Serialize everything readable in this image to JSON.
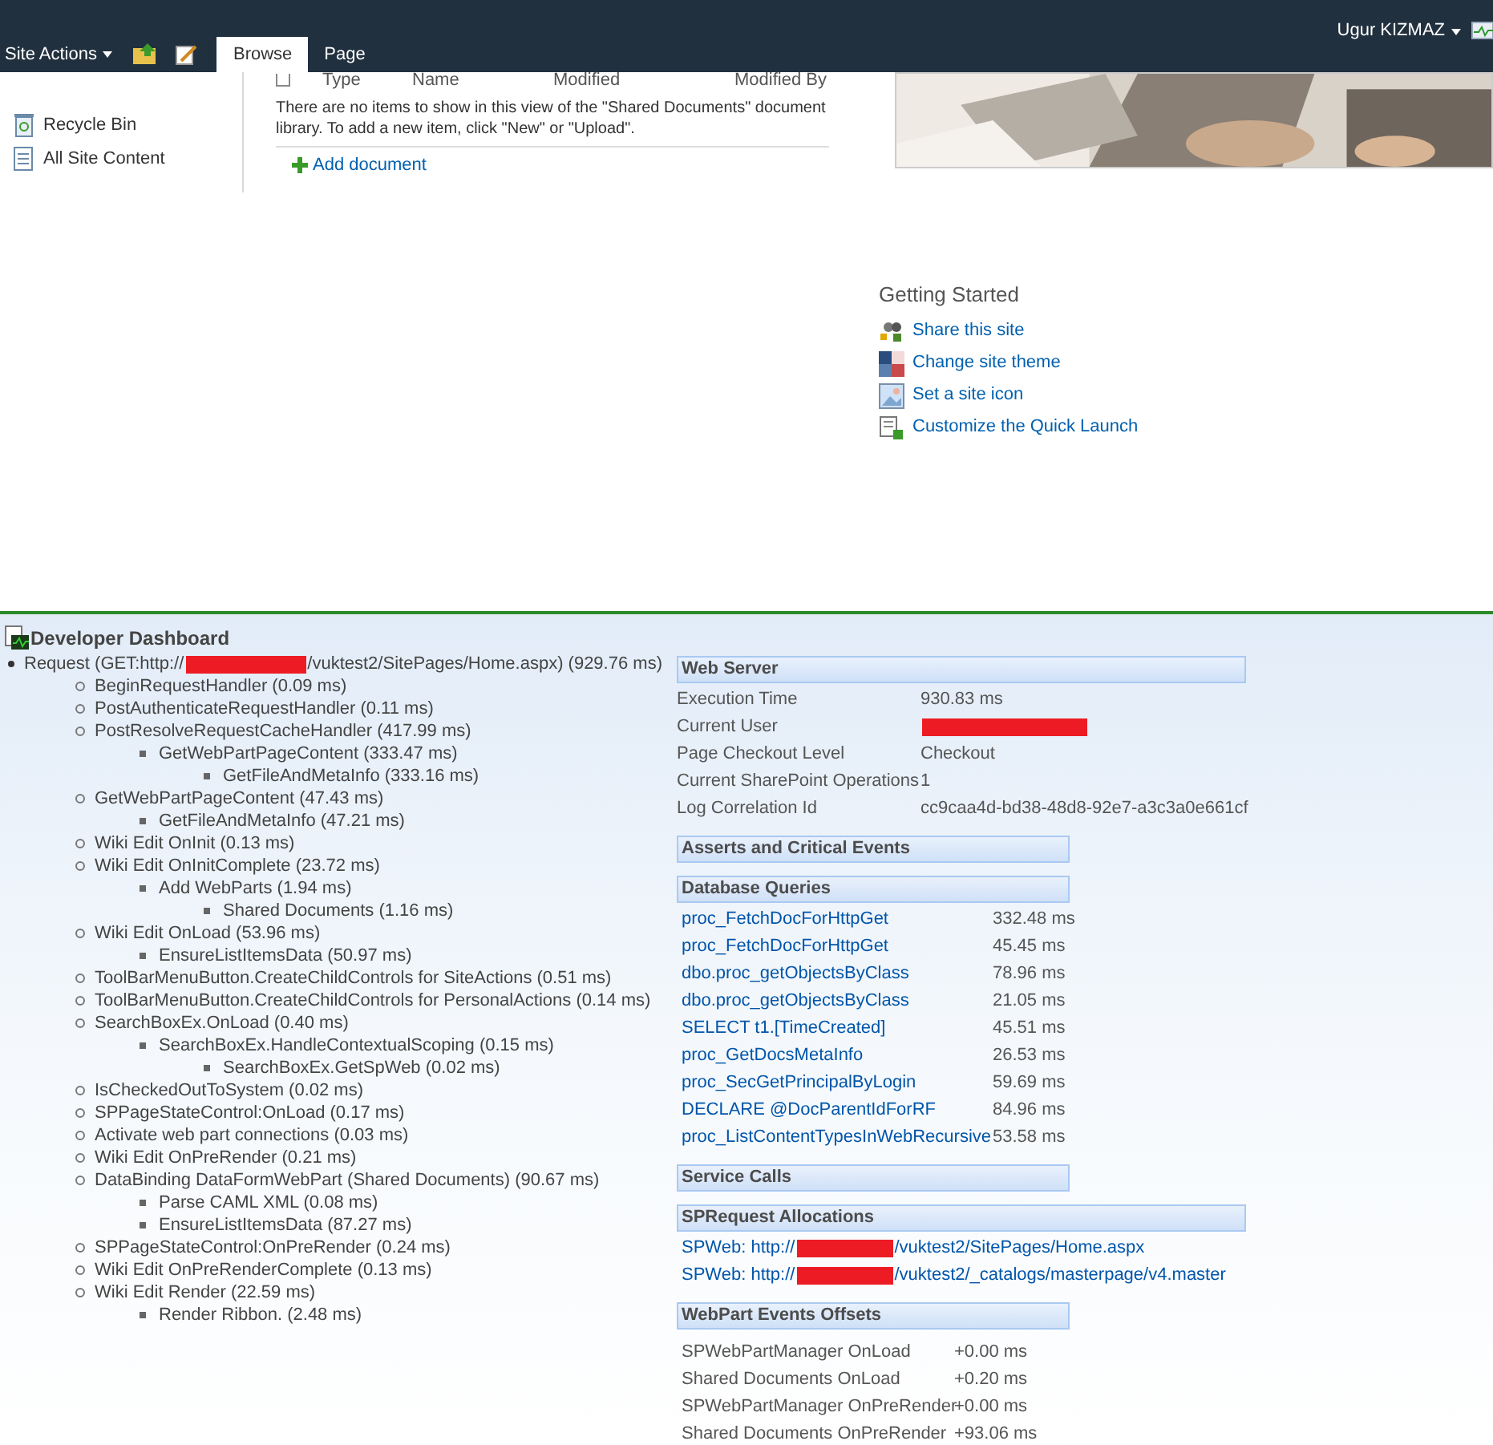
{
  "top_bar": {
    "site_actions": "Site Actions",
    "tabs": [
      {
        "label": "Browse",
        "selected": true
      },
      {
        "label": "Page",
        "selected": false
      }
    ],
    "user": "Ugur KIZMAZ"
  },
  "quick_launch": [
    "Recycle Bin",
    "All Site Content"
  ],
  "library": {
    "columns": [
      "Type",
      "Name",
      "Modified",
      "Modified By"
    ],
    "empty_message": "There are no items to show in this view of the \"Shared Documents\" document library. To add a new item, click \"New\" or \"Upload\".",
    "add_link": "Add document"
  },
  "getting_started": {
    "title": "Getting Started",
    "links": [
      "Share this site",
      "Change site theme",
      "Set a site icon",
      "Customize the Quick Launch"
    ]
  },
  "dashboard": {
    "title": "Developer Dashboard",
    "tree": [
      {
        "before": "Request (GET:http://",
        "after": "/vuktest2/SitePages/Home.aspx) (929.76 ms)",
        "children": [
          {
            "text": "BeginRequestHandler (0.09 ms)"
          },
          {
            "text": "PostAuthenticateRequestHandler (0.11 ms)"
          },
          {
            "text": "PostResolveRequestCacheHandler (417.99 ms)",
            "children": [
              {
                "text": "GetWebPartPageContent (333.47 ms)",
                "children": [
                  {
                    "text": "GetFileAndMetaInfo (333.16 ms)"
                  }
                ]
              }
            ]
          },
          {
            "text": "GetWebPartPageContent (47.43 ms)",
            "children": [
              {
                "text": "GetFileAndMetaInfo (47.21 ms)"
              }
            ]
          },
          {
            "text": "Wiki Edit OnInit (0.13 ms)"
          },
          {
            "text": "Wiki Edit OnInitComplete (23.72 ms)",
            "children": [
              {
                "text": "Add WebParts (1.94 ms)",
                "children": [
                  {
                    "text": "Shared Documents (1.16 ms)"
                  }
                ]
              }
            ]
          },
          {
            "text": "Wiki Edit OnLoad (53.96 ms)",
            "children": [
              {
                "text": "EnsureListItemsData (50.97 ms)"
              }
            ]
          },
          {
            "text": "ToolBarMenuButton.CreateChildControls for SiteActions (0.51 ms)"
          },
          {
            "text": "ToolBarMenuButton.CreateChildControls for PersonalActions (0.14 ms)"
          },
          {
            "text": "SearchBoxEx.OnLoad (0.40 ms)",
            "children": [
              {
                "text": "SearchBoxEx.HandleContextualScoping (0.15 ms)",
                "children": [
                  {
                    "text": "SearchBoxEx.GetSpWeb (0.02 ms)"
                  }
                ]
              }
            ]
          },
          {
            "text": "IsCheckedOutToSystem (0.02 ms)"
          },
          {
            "text": "SPPageStateControl:OnLoad (0.17 ms)"
          },
          {
            "text": "Activate web part connections (0.03 ms)"
          },
          {
            "text": "Wiki Edit OnPreRender (0.21 ms)"
          },
          {
            "text": "DataBinding DataFormWebPart (Shared Documents) (90.67 ms)",
            "children": [
              {
                "text": "Parse CAML XML (0.08 ms)"
              },
              {
                "text": "EnsureListItemsData (87.27 ms)"
              }
            ]
          },
          {
            "text": "SPPageStateControl:OnPreRender (0.24 ms)"
          },
          {
            "text": "Wiki Edit OnPreRenderComplete (0.13 ms)"
          },
          {
            "text": "Wiki Edit Render (22.59 ms)",
            "children": [
              {
                "text": "Render Ribbon. (2.48 ms)"
              }
            ]
          }
        ]
      }
    ],
    "sections": [
      {
        "title": "Web Server",
        "kind": "kv",
        "wide": true,
        "rows": [
          {
            "label": "Execution Time",
            "value": "930.83 ms",
            "redacted": false
          },
          {
            "label": "Current User",
            "redacted": true
          },
          {
            "label": "Page Checkout Level",
            "value": "Checkout",
            "redacted": false
          },
          {
            "label": "Current SharePoint Operations",
            "value": "1",
            "redacted": false
          },
          {
            "label": "Log Correlation Id",
            "value": "cc9caa4d-bd38-48d8-92e7-a3c3a0e661cf",
            "redacted": false
          }
        ]
      },
      {
        "title": "Asserts and Critical Events",
        "kind": "empty",
        "wide": false
      },
      {
        "title": "Database Queries",
        "kind": "queries",
        "wide": false,
        "rows": [
          {
            "label": "proc_FetchDocForHttpGet",
            "value": "332.48 ms"
          },
          {
            "label": "proc_FetchDocForHttpGet",
            "value": "45.45 ms"
          },
          {
            "label": "dbo.proc_getObjectsByClass",
            "value": "78.96 ms"
          },
          {
            "label": "dbo.proc_getObjectsByClass",
            "value": "21.05 ms"
          },
          {
            "label": "SELECT t1.[TimeCreated]",
            "value": "45.51 ms"
          },
          {
            "label": "proc_GetDocsMetaInfo",
            "value": "26.53 ms"
          },
          {
            "label": "proc_SecGetPrincipalByLogin",
            "value": "59.69 ms"
          },
          {
            "label": "DECLARE @DocParentIdForRF",
            "value": "84.96 ms"
          },
          {
            "label": "proc_ListContentTypesInWebRecursive",
            "value": "53.58 ms"
          }
        ]
      },
      {
        "title": "Service Calls",
        "kind": "empty",
        "wide": false
      },
      {
        "title": "SPRequest Allocations",
        "kind": "allocations",
        "wide": true,
        "rows": [
          {
            "before": "SPWeb: http://",
            "after": "/vuktest2/SitePages/Home.aspx"
          },
          {
            "before": "SPWeb: http://",
            "after": "/vuktest2/_catalogs/masterpage/v4.master"
          }
        ]
      },
      {
        "title": "WebPart Events Offsets",
        "kind": "offsets",
        "wide": false,
        "rows": [
          {
            "label": "SPWebPartManager OnLoad",
            "value": "+0.00 ms"
          },
          {
            "label": "Shared Documents OnLoad",
            "value": "+0.20 ms"
          },
          {
            "label": "SPWebPartManager OnPreRender",
            "value": "+0.00 ms"
          },
          {
            "label": "Shared Documents OnPreRender",
            "value": "+93.06 ms"
          }
        ]
      }
    ]
  }
}
